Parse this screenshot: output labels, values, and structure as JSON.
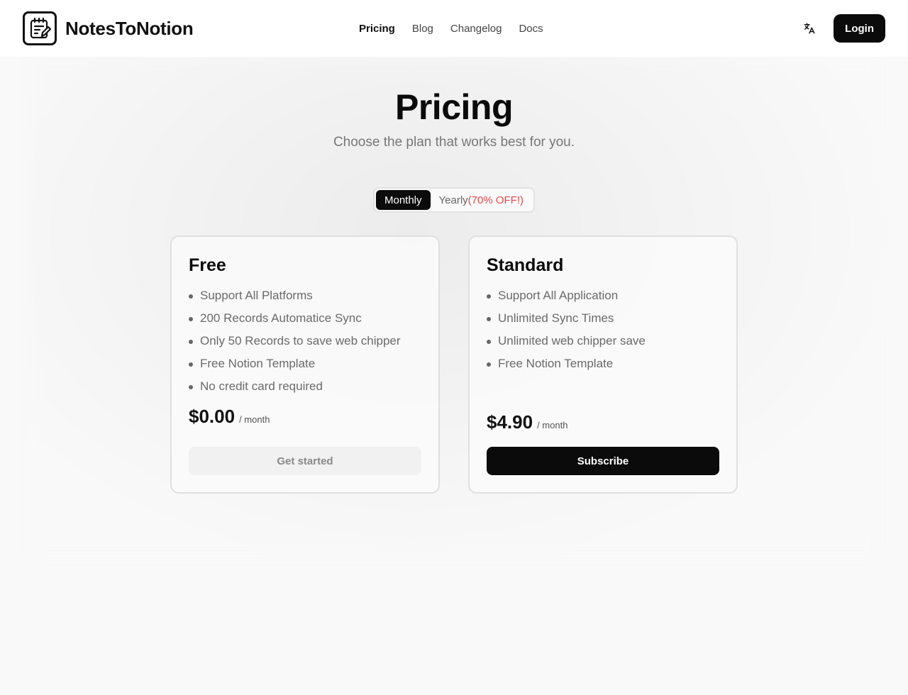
{
  "brand": {
    "name": "NotesToNotion",
    "logo_icon": "notepad-pencil-icon"
  },
  "nav": {
    "items": [
      {
        "label": "Pricing",
        "active": true
      },
      {
        "label": "Blog",
        "active": false
      },
      {
        "label": "Changelog",
        "active": false
      },
      {
        "label": "Docs",
        "active": false
      }
    ]
  },
  "header": {
    "language_icon": "translate-icon",
    "login_label": "Login"
  },
  "hero": {
    "title": "Pricing",
    "subtitle": "Choose the plan that works best for you."
  },
  "billing_toggle": {
    "monthly_label": "Monthly",
    "yearly_label": "Yearly",
    "yearly_discount": "(70% OFF!)",
    "selected": "Monthly"
  },
  "plans": [
    {
      "name": "Free",
      "features": [
        "Support All Platforms",
        "200 Records Automatice Sync",
        "Only 50 Records to save web chipper",
        "Free Notion Template",
        "No credit card required"
      ],
      "price": "$0.00",
      "period": "/ month",
      "button_label": "Get started"
    },
    {
      "name": "Standard",
      "features": [
        "Support All Application",
        "Unlimited Sync Times",
        "Unlimited web chipper save",
        "Free Notion Template"
      ],
      "price": "$4.90",
      "period": "/ month",
      "button_label": "Subscribe"
    }
  ],
  "colors": {
    "primary": "#0b0b0b",
    "discount": "#e0474c",
    "background": "#f9f9f9"
  }
}
